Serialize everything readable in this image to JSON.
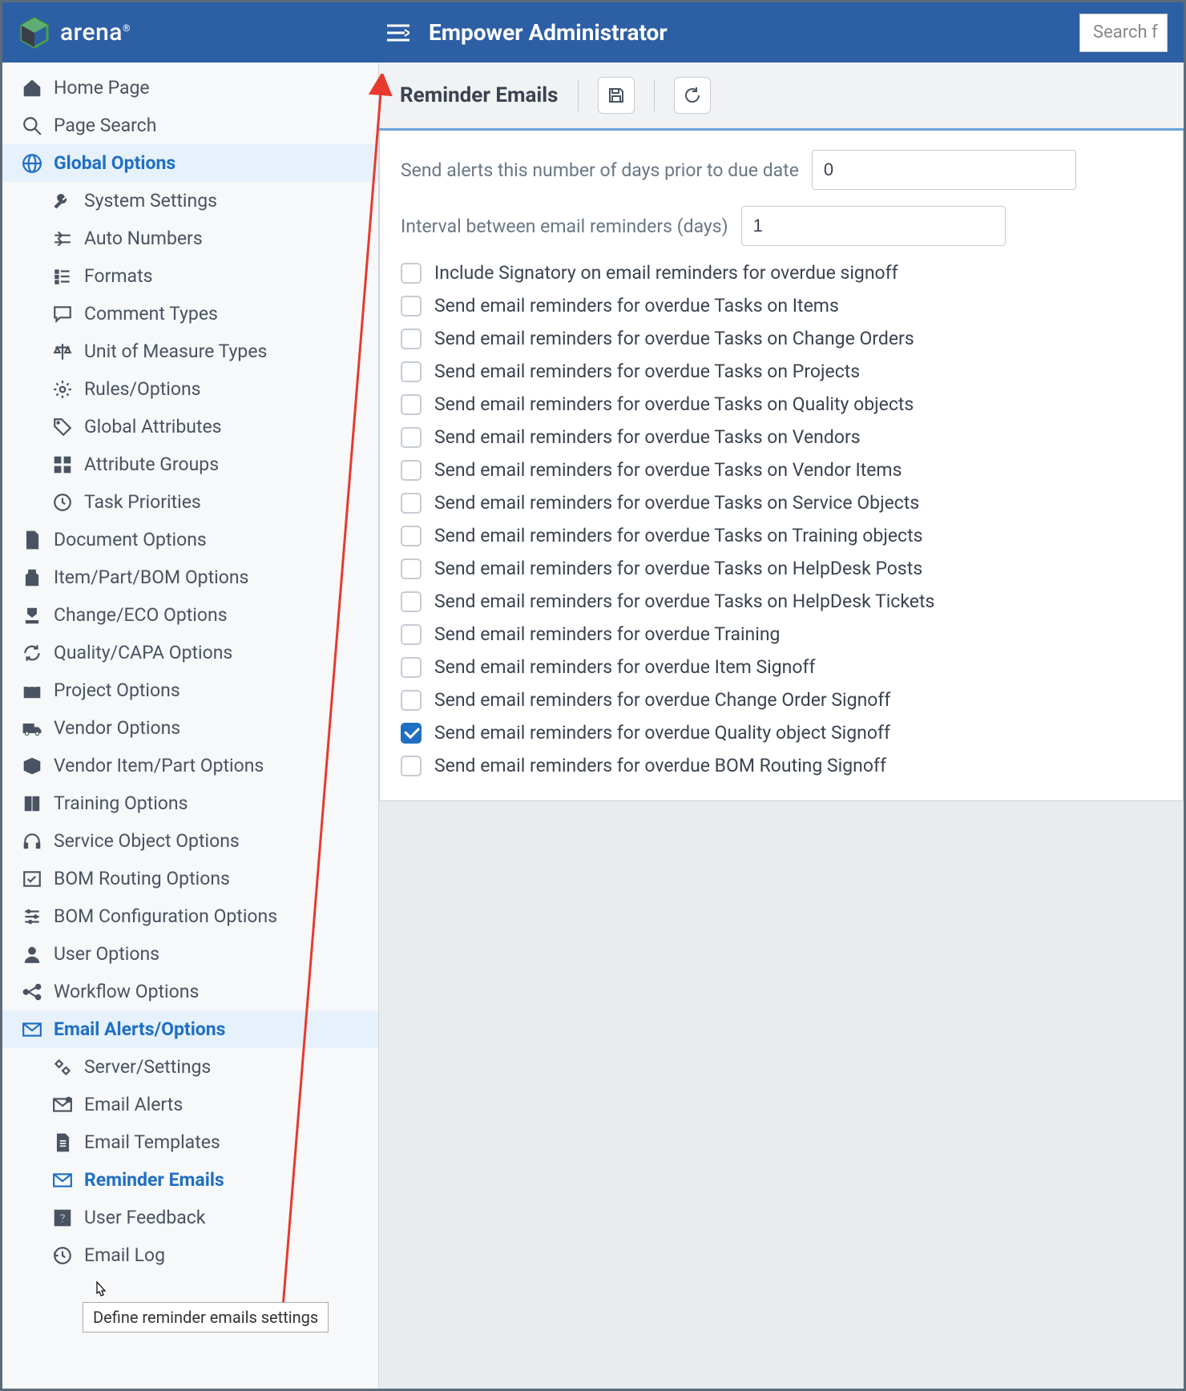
{
  "header": {
    "brand": "arena",
    "title": "Empower Administrator",
    "search_placeholder": "Search f"
  },
  "sidebar": {
    "home": "Home Page",
    "page_search": "Page Search",
    "global_options": {
      "label": "Global Options",
      "children": [
        "System Settings",
        "Auto Numbers",
        "Formats",
        "Comment Types",
        "Unit of Measure Types",
        "Rules/Options",
        "Global Attributes",
        "Attribute Groups",
        "Task Priorities"
      ]
    },
    "sections": [
      "Document Options",
      "Item/Part/BOM Options",
      "Change/ECO Options",
      "Quality/CAPA Options",
      "Project Options",
      "Vendor Options",
      "Vendor Item/Part Options",
      "Training Options",
      "Service Object Options",
      "BOM Routing Options",
      "BOM Configuration Options",
      "User Options",
      "Workflow Options"
    ],
    "email_alerts": {
      "label": "Email Alerts/Options",
      "children": [
        "Server/Settings",
        "Email Alerts",
        "Email Templates",
        "Reminder Emails",
        "User Feedback",
        "Email Log"
      ],
      "active_child": "Reminder Emails"
    }
  },
  "content": {
    "title": "Reminder Emails",
    "fields": {
      "days_prior": {
        "label": "Send alerts this number of days prior to due date",
        "value": "0"
      },
      "interval": {
        "label": "Interval between email reminders (days)",
        "value": "1"
      }
    },
    "checks": [
      {
        "label": "Include Signatory on email reminders for overdue signoff",
        "checked": false
      },
      {
        "label": "Send email reminders for overdue Tasks on Items",
        "checked": false
      },
      {
        "label": "Send email reminders for overdue Tasks on Change Orders",
        "checked": false
      },
      {
        "label": "Send email reminders for overdue Tasks on Projects",
        "checked": false
      },
      {
        "label": "Send email reminders for overdue Tasks on Quality objects",
        "checked": false
      },
      {
        "label": "Send email reminders for overdue Tasks on Vendors",
        "checked": false
      },
      {
        "label": "Send email reminders for overdue Tasks on Vendor Items",
        "checked": false
      },
      {
        "label": "Send email reminders for overdue Tasks on Service Objects",
        "checked": false
      },
      {
        "label": "Send email reminders for overdue Tasks on Training objects",
        "checked": false
      },
      {
        "label": "Send email reminders for overdue Tasks on HelpDesk Posts",
        "checked": false
      },
      {
        "label": "Send email reminders for overdue Tasks on HelpDesk Tickets",
        "checked": false
      },
      {
        "label": "Send email reminders for overdue Training",
        "checked": false
      },
      {
        "label": "Send email reminders for overdue Item Signoff",
        "checked": false
      },
      {
        "label": "Send email reminders for overdue Change Order Signoff",
        "checked": false
      },
      {
        "label": "Send email reminders for overdue Quality object Signoff",
        "checked": true
      },
      {
        "label": "Send email reminders for overdue BOM Routing Signoff",
        "checked": false
      }
    ]
  },
  "tooltip": "Define reminder emails settings"
}
